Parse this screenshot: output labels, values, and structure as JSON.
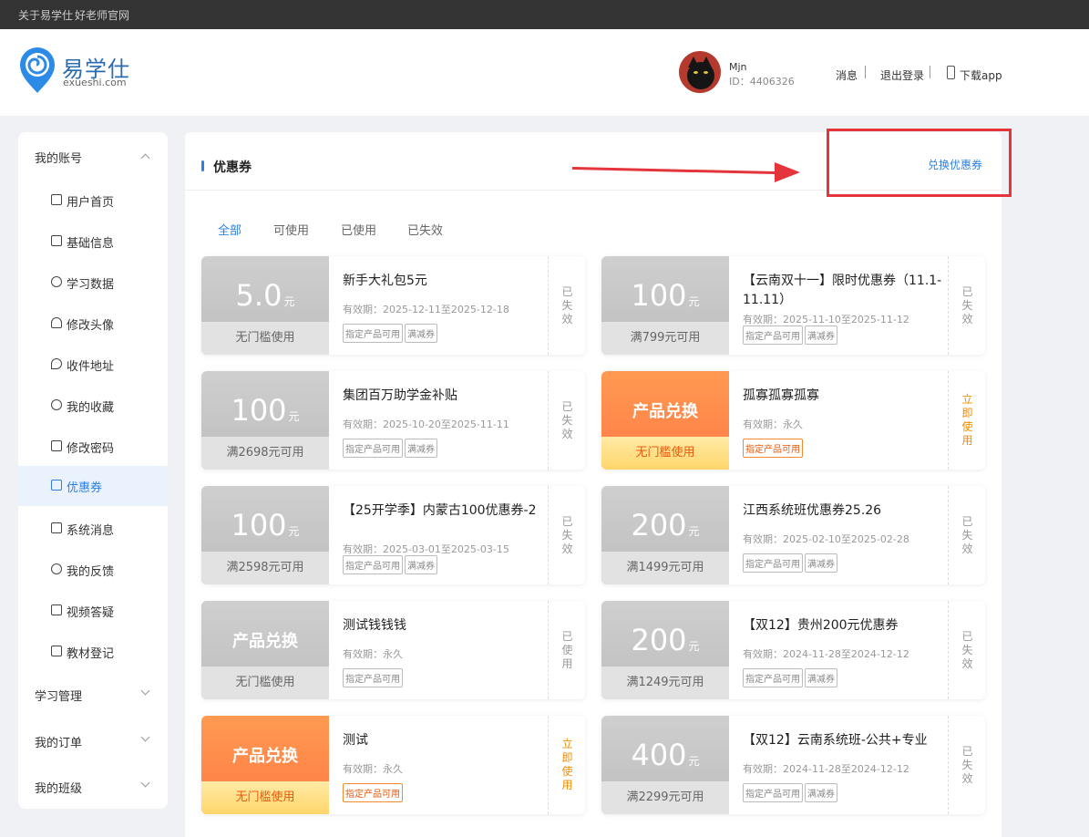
{
  "topbar": {
    "link1": "关于易学仕",
    "link2": "好老师官网"
  },
  "logo": {
    "title": "易学仕",
    "subtitle": "exueshi.com"
  },
  "user": {
    "name": "Mjn",
    "id": "ID：4406326"
  },
  "header_links": {
    "messages": "消息",
    "logout": "退出登录",
    "download": "下载app"
  },
  "sidebar": {
    "account": "我的账号",
    "items": [
      {
        "label": "用户首页"
      },
      {
        "label": "基础信息"
      },
      {
        "label": "学习数据"
      },
      {
        "label": "修改头像"
      },
      {
        "label": "收件地址"
      },
      {
        "label": "我的收藏"
      },
      {
        "label": "修改密码"
      },
      {
        "label": "优惠券"
      },
      {
        "label": "系统消息"
      },
      {
        "label": "我的反馈"
      },
      {
        "label": "视频答疑"
      },
      {
        "label": "教材登记"
      }
    ],
    "study": "学习管理",
    "orders": "我的订单",
    "classes": "我的班级"
  },
  "main": {
    "title": "优惠券",
    "redeem": "兑换优惠券",
    "tabs": [
      "全部",
      "可使用",
      "已使用",
      "已失效"
    ]
  },
  "unit": "元",
  "coupons": [
    {
      "amount": "5.0",
      "cond": "无门槛使用",
      "name": "新手大礼包5元",
      "valid": "有效期：2025-12-11至2025-12-18",
      "tags": [
        "指定产品可用",
        "满减券"
      ],
      "status": [
        "已",
        "失",
        "效"
      ]
    },
    {
      "amount": "100",
      "cond": "满799元可用",
      "name": "【云南双十一】限时优惠券（11.1-11.11）",
      "valid": "有效期：2025-11-10至2025-11-12",
      "tags": [
        "指定产品可用",
        "满减券"
      ],
      "status": [
        "已",
        "失",
        "效"
      ]
    },
    {
      "amount": "100",
      "cond": "满2698元可用",
      "name": "集团百万助学金补贴",
      "valid": "有效期：2025-10-20至2025-11-11",
      "tags": [
        "指定产品可用",
        "满减券"
      ],
      "status": [
        "已",
        "失",
        "效"
      ]
    },
    {
      "ptxt": "产品兑换",
      "cond": "无门槛使用",
      "name": "孤寡孤寡孤寡",
      "valid": "有效期：永久",
      "tags": [
        "指定产品可用"
      ],
      "status": [
        "立",
        "即",
        "使",
        "用"
      ]
    },
    {
      "amount": "100",
      "cond": "满2598元可用",
      "name": "【25开学季】内蒙古100优惠券-2",
      "valid": "有效期：2025-03-01至2025-03-15",
      "tags": [
        "指定产品可用",
        "满减券"
      ],
      "status": [
        "已",
        "失",
        "效"
      ]
    },
    {
      "amount": "200",
      "cond": "满1499元可用",
      "name": "江西系统班优惠券25.26",
      "valid": "有效期：2025-02-10至2025-02-28",
      "tags": [
        "指定产品可用",
        "满减券"
      ],
      "status": [
        "已",
        "失",
        "效"
      ]
    },
    {
      "ptxt": "产品兑换",
      "cond": "无门槛使用",
      "name": "测试钱钱钱",
      "valid": "有效期：永久",
      "tags": [
        "指定产品可用"
      ],
      "status": [
        "已",
        "使",
        "用"
      ]
    },
    {
      "amount": "200",
      "cond": "满1249元可用",
      "name": "【双12】贵州200元优惠券",
      "valid": "有效期：2024-11-28至2024-12-12",
      "tags": [
        "指定产品可用",
        "满减券"
      ],
      "status": [
        "已",
        "失",
        "效"
      ]
    },
    {
      "ptxt": "产品兑换",
      "cond": "无门槛使用",
      "name": "测试",
      "valid": "有效期：永久",
      "tags": [
        "指定产品可用"
      ],
      "status": [
        "立",
        "即",
        "使",
        "用"
      ]
    },
    {
      "amount": "400",
      "cond": "满2299元可用",
      "name": "【双12】云南系统班-公共+专业",
      "valid": "有效期：2024-11-28至2024-12-12",
      "tags": [
        "指定产品可用",
        "满减券"
      ],
      "status": [
        "已",
        "失",
        "效"
      ]
    }
  ],
  "colors": {
    "accent": "#2e7fe0",
    "annotation": "#e5353c",
    "orange": "#ff7a45"
  }
}
